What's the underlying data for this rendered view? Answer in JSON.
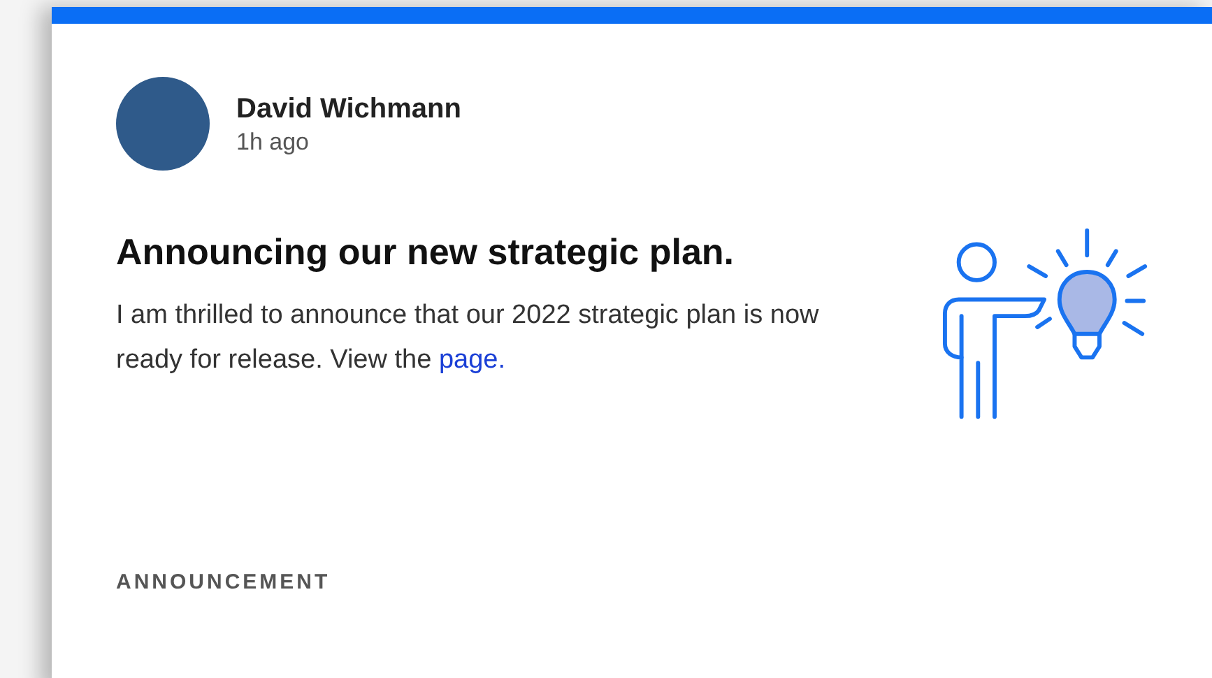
{
  "post": {
    "author": "David Wichmann",
    "time": "1h ago",
    "title": "Announcing our new strategic plan.",
    "body": "I am thrilled to announce that our 2022 strategic plan is now ready for release. View the",
    "link": "page.",
    "tag": "ANNOUNCEMENT"
  }
}
